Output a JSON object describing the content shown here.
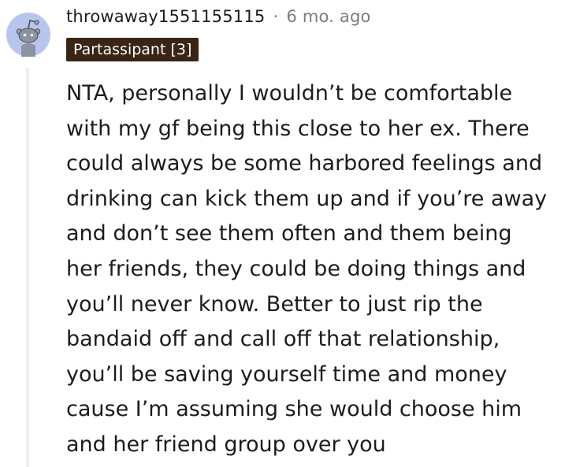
{
  "comment": {
    "author": "throwaway1551155115",
    "separator": "·",
    "age": "6 mo. ago",
    "flair": "Partassipant [3]",
    "avatar_icon": "snoo-avatar-icon",
    "body": "NTA, personally I wouldn’t be comfortable\nwith my gf being this close to her ex. There\ncould always be some harbored feelings and\ndrinking can kick them up and if you’re away\nand don’t see them often and them being\nher friends, they could be doing things and\nyou’ll never know. Better to just rip the\nbandaid off and call off that relationship,\nyou’ll be saving yourself time and money\ncause I’m assuming she would choose him\nand her friend group over you"
  },
  "colors": {
    "flair_bg": "#3a2413",
    "flair_text": "#ffffff",
    "text": "#1c1c1c",
    "muted": "#7c7c7c",
    "thread_line": "#edeff1",
    "avatar_bg": "#b8c6ee"
  }
}
